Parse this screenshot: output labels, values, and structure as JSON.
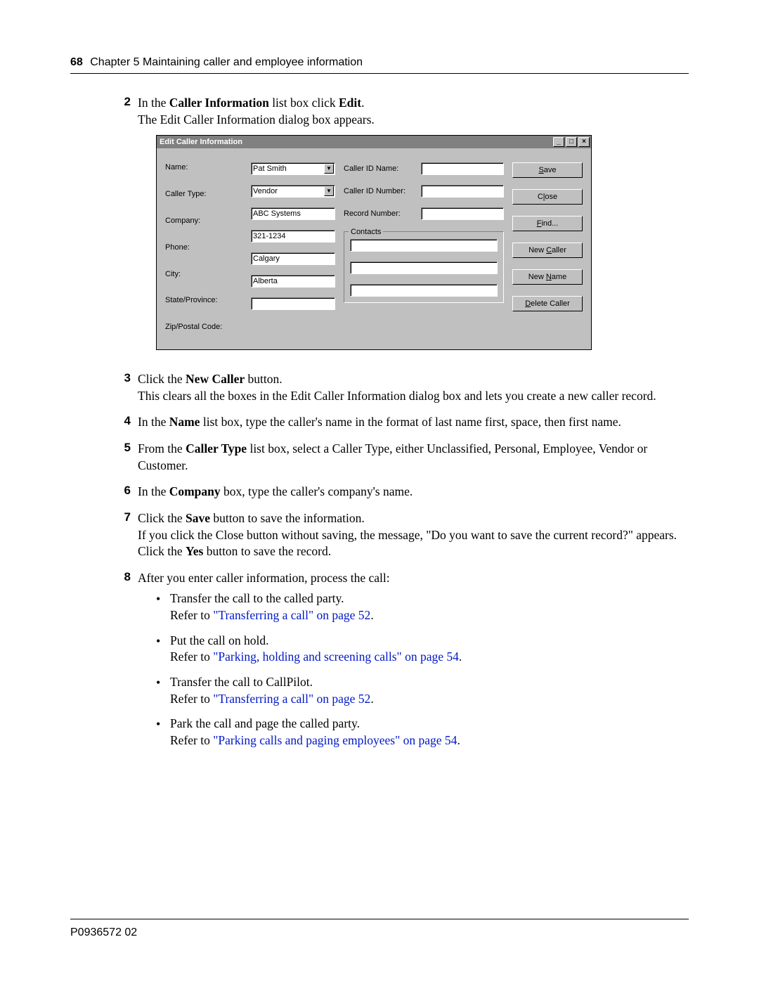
{
  "header": {
    "page_number": "68",
    "chapter_line": "Chapter 5  Maintaining caller and employee information"
  },
  "steps": {
    "2": {
      "num": "2",
      "line1_pre": "In the ",
      "line1_b1": "Caller Information",
      "line1_mid": " list box click ",
      "line1_b2": "Edit",
      "line1_post": ".",
      "line2": "The Edit Caller Information dialog box appears."
    },
    "3": {
      "num": "3",
      "line1_pre": "Click the ",
      "line1_b1": "New Caller",
      "line1_post": " button.",
      "line2": "This clears all the boxes in the Edit Caller Information dialog box and lets you create a new caller record."
    },
    "4": {
      "num": "4",
      "line1_pre": "In the ",
      "line1_b1": "Name",
      "line1_post": " list box, type the caller's name in the format of last name first, space, then first name."
    },
    "5": {
      "num": "5",
      "line1_pre": "From the ",
      "line1_b1": "Caller Type",
      "line1_post": " list box, select a Caller Type, either Unclassified, Personal, Employee, Vendor or Customer."
    },
    "6": {
      "num": "6",
      "line1_pre": "In the ",
      "line1_b1": "Company",
      "line1_post": " box, type the caller's company's name."
    },
    "7": {
      "num": "7",
      "line1_pre": "Click the ",
      "line1_b1": "Save",
      "line1_post": " button to save the information.",
      "line2_pre": "If you click the Close button without saving, the message, \"Do you want to save the current record?\" appears. Click the ",
      "line2_b1": "Yes",
      "line2_post": " button to save the record."
    },
    "8": {
      "num": "8",
      "line1": "After you enter caller information, process the call:"
    }
  },
  "bullets": {
    "b1": {
      "t1": "Transfer the call to the called party.",
      "t2a": "Refer to ",
      "t2link": "\"Transferring a call\" on page 52",
      "t2b": "."
    },
    "b2": {
      "t1": "Put the call on hold.",
      "t2a": "Refer to ",
      "t2link": "\"Parking, holding and screening calls\" on page 54",
      "t2b": "."
    },
    "b3": {
      "t1": "Transfer the call to CallPilot.",
      "t2a": "Refer to ",
      "t2link": "\"Transferring a call\" on page 52",
      "t2b": "."
    },
    "b4": {
      "t1": "Park the call and page the called party.",
      "t2a": "Refer to ",
      "t2link": "\"Parking calls and paging employees\" on page 54",
      "t2b": "."
    }
  },
  "dialog": {
    "title": "Edit Caller Information",
    "labels": {
      "name": "Name:",
      "caller_type": "Caller Type:",
      "company": "Company:",
      "phone": "Phone:",
      "city": "City:",
      "state": "State/Province:",
      "zip": "Zip/Postal Code:",
      "caller_id_name": "Caller ID Name:",
      "caller_id_number": "Caller ID Number:",
      "record_number": "Record Number:",
      "contacts": "Contacts"
    },
    "values": {
      "name": "Pat Smith",
      "caller_type": "Vendor",
      "company": "ABC Systems",
      "phone": "321-1234",
      "city": "Calgary",
      "state": "Alberta",
      "zip": "",
      "caller_id_name": "",
      "caller_id_number": "",
      "record_number": "",
      "contact1": "",
      "contact2": "",
      "contact3": ""
    },
    "buttons": {
      "save": "Save",
      "close": "Close",
      "find": "Find...",
      "new_caller": "New Caller",
      "new_name": "New Name",
      "delete_caller": "Delete Caller"
    },
    "window_buttons": {
      "min": "_",
      "max": "□",
      "close": "×"
    }
  },
  "footer": {
    "doc_id": "P0936572 02"
  }
}
